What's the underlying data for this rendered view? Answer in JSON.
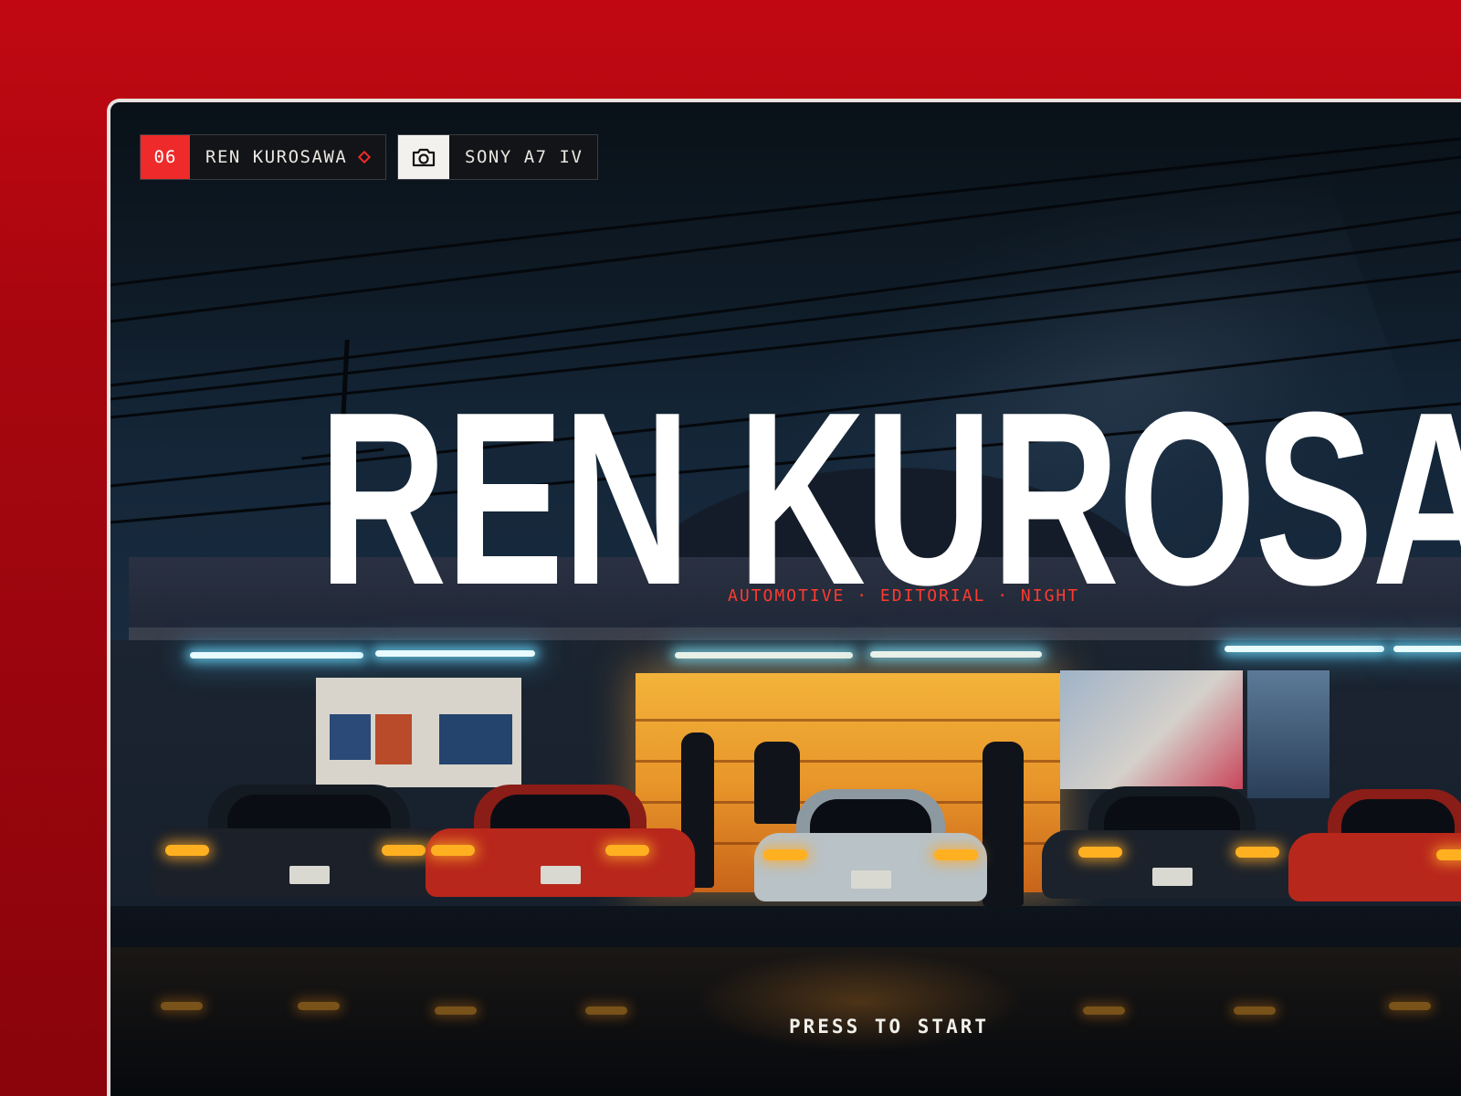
{
  "header": {
    "artist_chip": {
      "number": "06",
      "label": "REN KUROSAWA",
      "marker_icon": "diamond-icon"
    },
    "camera_chip": {
      "icon": "camera-icon",
      "label": "SONY A7 IV"
    }
  },
  "hero": {
    "title": "REN KUROSAWA",
    "tagline": "AUTOMOTIVE · EDITORIAL · NIGHT",
    "cta": "PRESS TO START"
  },
  "colors": {
    "accent": "#ee2a2a",
    "page_background": "#b3070f",
    "title": "#ffffff",
    "tagline": "#ff3a2e"
  }
}
